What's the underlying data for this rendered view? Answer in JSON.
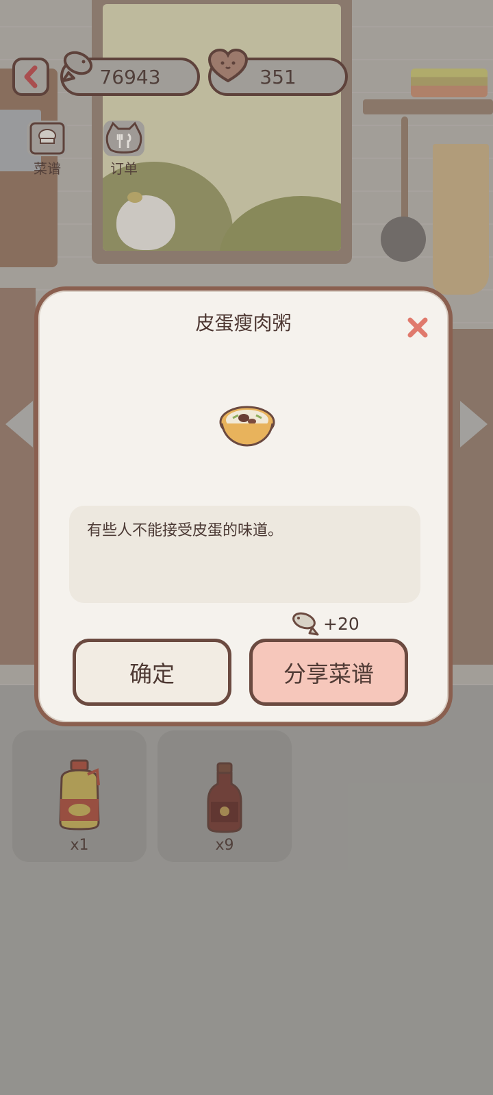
{
  "hud": {
    "fish_count": "76943",
    "heart_count": "351",
    "recipe_label": "菜谱",
    "order_label": "订单"
  },
  "dialog": {
    "title": "皮蛋瘦肉粥",
    "description": "有些人不能接受皮蛋的味道。",
    "reward": "+20",
    "confirm_label": "确定",
    "share_label": "分享菜谱"
  },
  "inventory": [
    {
      "item": "cooking-oil",
      "count": "x1"
    },
    {
      "item": "soy-sauce",
      "count": "x9"
    }
  ],
  "colors": {
    "dialog_border": "#8a5f4f",
    "share_button": "#f6c7bb",
    "close_icon": "#e07a6d"
  }
}
